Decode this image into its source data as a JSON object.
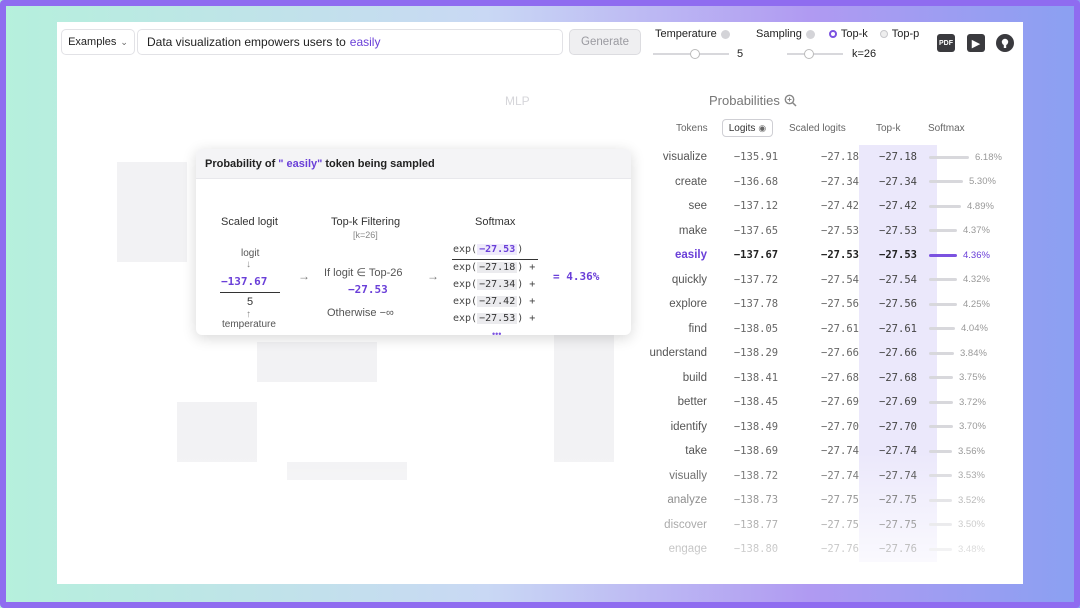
{
  "toolbar": {
    "examples_label": "Examples",
    "prompt_text": "Data visualization empowers users to",
    "prompt_highlight": "easily",
    "generate_label": "Generate"
  },
  "controls": {
    "temperature_label": "Temperature",
    "temperature_value": "5",
    "temperature_level": 0.55,
    "sampling_label": "Sampling",
    "topk_label": "Top-k",
    "topp_label": "Top-p",
    "k_value": "k=26",
    "k_level": 0.4
  },
  "header_icons": [
    "pdf-icon",
    "youtube-icon",
    "github-icon"
  ],
  "background": {
    "mlp_label": "MLP"
  },
  "probabilities": {
    "title": "Probabilities",
    "columns": {
      "tokens": "Tokens",
      "logits": "Logits",
      "scaled": "Scaled logits",
      "topk": "Top-k",
      "softmax": "Softmax"
    },
    "rows": [
      {
        "token": "visualize",
        "logit": "−135.91",
        "scaled": "−27.18",
        "topk": "−27.18",
        "softmax": "6.18%"
      },
      {
        "token": "create",
        "logit": "−136.68",
        "scaled": "−27.34",
        "topk": "−27.34",
        "softmax": "5.30%"
      },
      {
        "token": "see",
        "logit": "−137.12",
        "scaled": "−27.42",
        "topk": "−27.42",
        "softmax": "4.89%"
      },
      {
        "token": "make",
        "logit": "−137.65",
        "scaled": "−27.53",
        "topk": "−27.53",
        "softmax": "4.37%"
      },
      {
        "token": "easily",
        "logit": "−137.67",
        "scaled": "−27.53",
        "topk": "−27.53",
        "softmax": "4.36%"
      },
      {
        "token": "quickly",
        "logit": "−137.72",
        "scaled": "−27.54",
        "topk": "−27.54",
        "softmax": "4.32%"
      },
      {
        "token": "explore",
        "logit": "−137.78",
        "scaled": "−27.56",
        "topk": "−27.56",
        "softmax": "4.25%"
      },
      {
        "token": "find",
        "logit": "−138.05",
        "scaled": "−27.61",
        "topk": "−27.61",
        "softmax": "4.04%"
      },
      {
        "token": "understand",
        "logit": "−138.29",
        "scaled": "−27.66",
        "topk": "−27.66",
        "softmax": "3.84%"
      },
      {
        "token": "build",
        "logit": "−138.41",
        "scaled": "−27.68",
        "topk": "−27.68",
        "softmax": "3.75%"
      },
      {
        "token": "better",
        "logit": "−138.45",
        "scaled": "−27.69",
        "topk": "−27.69",
        "softmax": "3.72%"
      },
      {
        "token": "identify",
        "logit": "−138.49",
        "scaled": "−27.70",
        "topk": "−27.70",
        "softmax": "3.70%"
      },
      {
        "token": "take",
        "logit": "−138.69",
        "scaled": "−27.74",
        "topk": "−27.74",
        "softmax": "3.56%"
      },
      {
        "token": "visually",
        "logit": "−138.72",
        "scaled": "−27.74",
        "topk": "−27.74",
        "softmax": "3.53%"
      },
      {
        "token": "analyze",
        "logit": "−138.73",
        "scaled": "−27.75",
        "topk": "−27.75",
        "softmax": "3.52%"
      },
      {
        "token": "discover",
        "logit": "−138.77",
        "scaled": "−27.75",
        "topk": "−27.75",
        "softmax": "3.50%"
      },
      {
        "token": "engage",
        "logit": "−138.80",
        "scaled": "−27.76",
        "topk": "−27.76",
        "softmax": "3.48%"
      }
    ]
  },
  "popup": {
    "title_prefix": "Probability of",
    "title_token": "\" easily\"",
    "title_suffix": "token being sampled",
    "col1_title": "Scaled logit",
    "col2_title": "Top-k Filtering",
    "col2_sub": "[k=26]",
    "col3_title": "Softmax",
    "logit_label": "logit",
    "logit_value": "−137.67",
    "temp_value": "5",
    "temp_label": "temperature",
    "if_text": "If logit ∈ Top-26",
    "if_value": "−27.53",
    "otherwise_text": "Otherwise −∞",
    "exp_numerator": "−27.53",
    "exp_denominators": [
      "−27.18",
      "−27.34",
      "−27.42",
      "−27.53"
    ],
    "result": "= 4.36%",
    "ellipsis": "•••"
  }
}
